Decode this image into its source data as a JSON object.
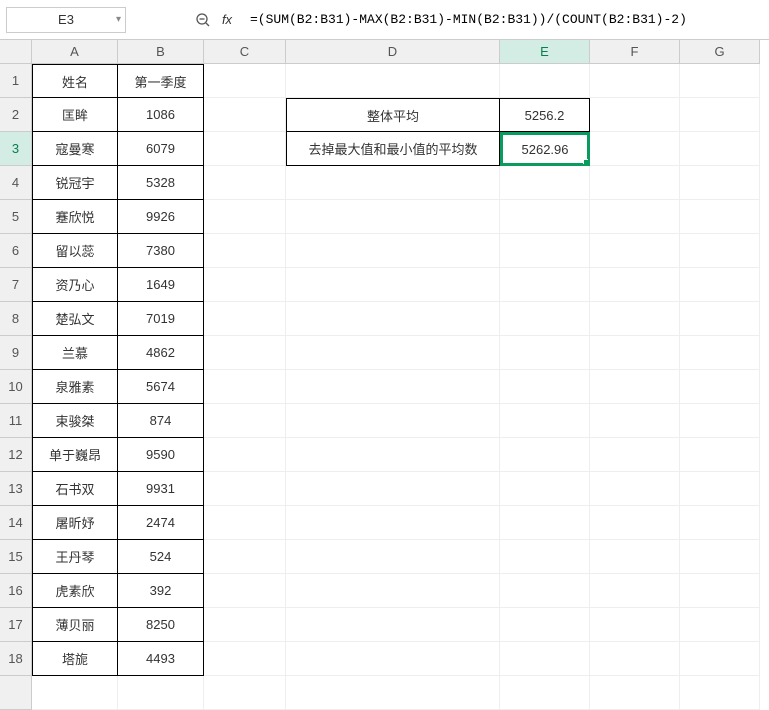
{
  "formula_bar": {
    "name_box": "E3",
    "formula": "=(SUM(B2:B31)-MAX(B2:B31)-MIN(B2:B31))/(COUNT(B2:B31)-2)",
    "fx_label": "fx"
  },
  "columns": [
    "A",
    "B",
    "C",
    "D",
    "E",
    "F",
    "G"
  ],
  "active_col": "E",
  "active_row": 3,
  "headers": {
    "A": "姓名",
    "B": "第一季度"
  },
  "table": [
    {
      "name": "匡眸",
      "q1": "1086"
    },
    {
      "name": "寇曼寒",
      "q1": "6079"
    },
    {
      "name": "锐冠宇",
      "q1": "5328"
    },
    {
      "name": "蹇欣悦",
      "q1": "9926"
    },
    {
      "name": "留以蕊",
      "q1": "7380"
    },
    {
      "name": "资乃心",
      "q1": "1649"
    },
    {
      "name": "楚弘文",
      "q1": "7019"
    },
    {
      "name": "兰慕",
      "q1": "4862"
    },
    {
      "name": "泉雅素",
      "q1": "5674"
    },
    {
      "name": "束骏桀",
      "q1": "874"
    },
    {
      "name": "单于巍昂",
      "q1": "9590"
    },
    {
      "name": "石书双",
      "q1": "9931"
    },
    {
      "name": "屠昕妤",
      "q1": "2474"
    },
    {
      "name": "王丹琴",
      "q1": "524"
    },
    {
      "name": "虎素欣",
      "q1": "392"
    },
    {
      "name": "薄贝丽",
      "q1": "8250"
    },
    {
      "name": "塔旎",
      "q1": "4493"
    }
  ],
  "summary": {
    "overall_label": "整体平均",
    "overall_value": "5256.2",
    "trimmed_label": "去掉最大值和最小值的平均数",
    "trimmed_value": "5262.96"
  }
}
